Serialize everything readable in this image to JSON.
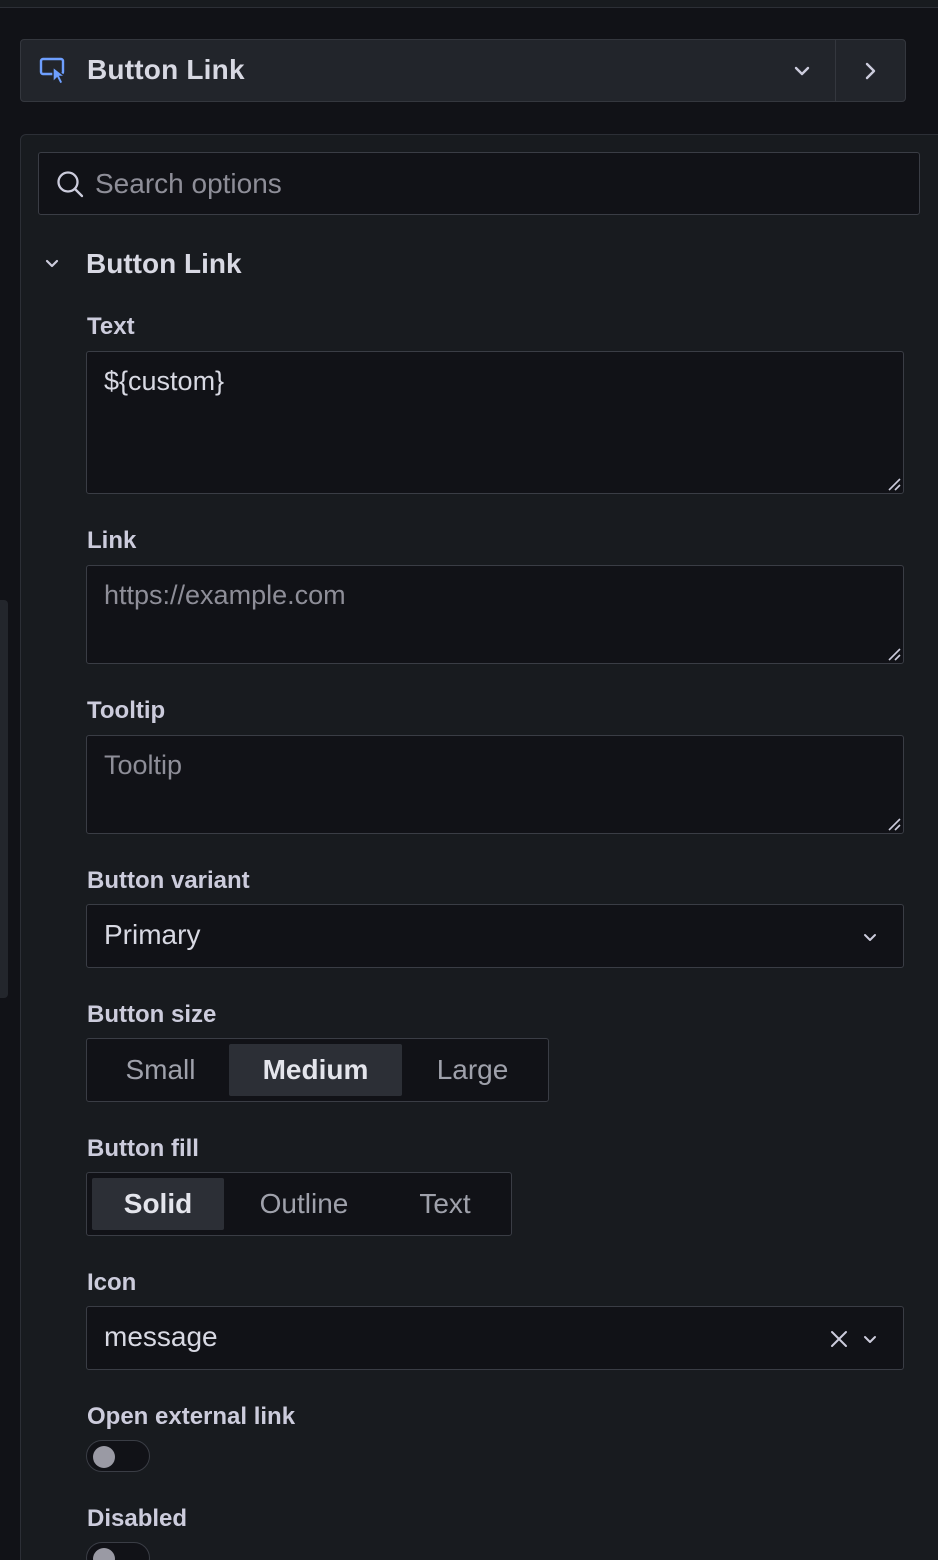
{
  "visualization": {
    "name": "Button Link",
    "icon": "button-link-icon"
  },
  "search": {
    "placeholder": "Search options"
  },
  "section": {
    "title": "Button Link"
  },
  "fields": {
    "text": {
      "label": "Text",
      "value": "${custom}"
    },
    "link": {
      "label": "Link",
      "value": "",
      "placeholder": "https://example.com"
    },
    "tooltip": {
      "label": "Tooltip",
      "value": "",
      "placeholder": "Tooltip"
    },
    "button_variant": {
      "label": "Button variant",
      "selected": "Primary"
    },
    "button_size": {
      "label": "Button size",
      "options": [
        "Small",
        "Medium",
        "Large"
      ],
      "selected": "Medium"
    },
    "button_fill": {
      "label": "Button fill",
      "options": [
        "Solid",
        "Outline",
        "Text"
      ],
      "selected": "Solid"
    },
    "icon": {
      "label": "Icon",
      "selected": "message"
    },
    "open_external_link": {
      "label": "Open external link",
      "enabled": false
    },
    "disabled": {
      "label": "Disabled",
      "enabled": false
    }
  },
  "colors": {
    "background": "#111217",
    "panel": "#181b1f",
    "accent_icon": "#6e9fff"
  }
}
